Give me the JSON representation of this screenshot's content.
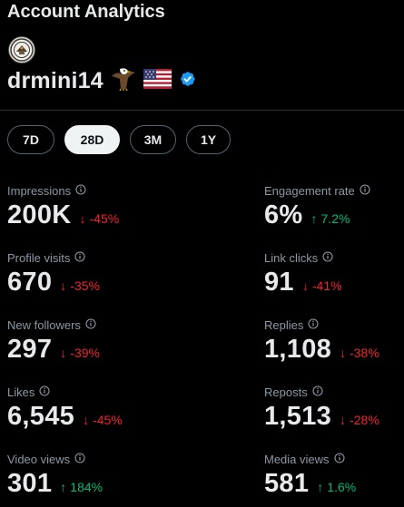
{
  "header": {
    "title": "Account Analytics"
  },
  "profile": {
    "username": "drmini14",
    "avatar_icon": "seal-avatar",
    "emojis": [
      "eagle-icon",
      "us-flag-icon"
    ],
    "verified": true
  },
  "tabs": [
    {
      "label": "7D",
      "active": false
    },
    {
      "label": "28D",
      "active": true
    },
    {
      "label": "3M",
      "active": false
    },
    {
      "label": "1Y",
      "active": false
    }
  ],
  "metrics": [
    {
      "label": "Impressions",
      "value": "200K",
      "change": "-45%",
      "direction": "down"
    },
    {
      "label": "Engagement rate",
      "value": "6%",
      "change": "7.2%",
      "direction": "up"
    },
    {
      "label": "Profile visits",
      "value": "670",
      "change": "-35%",
      "direction": "down"
    },
    {
      "label": "Link clicks",
      "value": "91",
      "change": "-41%",
      "direction": "down"
    },
    {
      "label": "New followers",
      "value": "297",
      "change": "-39%",
      "direction": "down"
    },
    {
      "label": "Replies",
      "value": "1,108",
      "change": "-38%",
      "direction": "down"
    },
    {
      "label": "Likes",
      "value": "6,545",
      "change": "-45%",
      "direction": "down"
    },
    {
      "label": "Reposts",
      "value": "1,513",
      "change": "-28%",
      "direction": "down"
    },
    {
      "label": "Video views",
      "value": "301",
      "change": "184%",
      "direction": "up"
    },
    {
      "label": "Media views",
      "value": "581",
      "change": "1.6%",
      "direction": "up"
    }
  ],
  "colors": {
    "up": "#00ba7c",
    "down": "#f4212e",
    "verified": "#1d9bf0",
    "background": "#000000"
  }
}
